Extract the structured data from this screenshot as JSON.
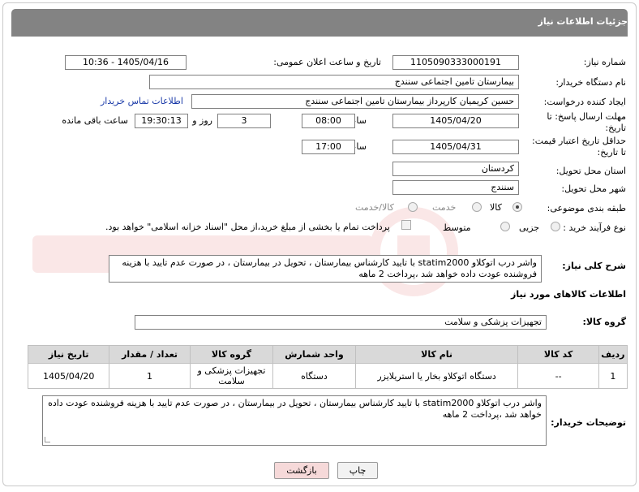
{
  "header": {
    "title": "جزئیات اطلاعات نیاز"
  },
  "form": {
    "need_number_label": "شماره نیاز:",
    "need_number": "1105090333000191",
    "announce_label": "تاریخ و ساعت اعلان عمومی:",
    "announce_value": "1405/04/16 - 10:36",
    "buyer_label": "نام دستگاه خریدار:",
    "buyer_value": "بیمارستان تامین اجتماعی سنندج",
    "creator_label": "ایجاد کننده درخواست:",
    "creator_value": "حسین کریمیان کارپرداز بیمارستان تامین اجتماعی سنندج",
    "contact_link": "اطلاعات تماس خریدار",
    "deadline_label_1": "مهلت ارسال پاسخ: تا",
    "deadline_label_2": "تاریخ:",
    "deadline_date": "1405/04/20",
    "hour_label": "ساعت",
    "deadline_time": "08:00",
    "days_value": "3",
    "days_label": "روز و",
    "remaining_time": "19:30:13",
    "remaining_label": "ساعت باقی مانده",
    "validity_label_1": "حداقل تاریخ اعتبار قیمت:",
    "validity_label_2": "تا تاریخ:",
    "validity_date": "1405/04/31",
    "validity_time": "17:00",
    "province_label": "استان محل تحویل:",
    "province_value": "کردستان",
    "city_label": "شهر محل تحویل:",
    "city_value": "سنندج",
    "category_label": "طبقه بندی موضوعی:",
    "category_options": [
      "کالا",
      "خدمت",
      "کالا/خدمت"
    ],
    "category_selected": "کالا",
    "process_label": "نوع فرآیند خرید :",
    "process_options": [
      "جزیی",
      "متوسط"
    ],
    "payment_note": "پرداخت تمام یا بخشی از مبلغ خرید،از محل \"اسناد خزانه اسلامی\" خواهد بود.",
    "description_label": "شرح کلی نیاز:",
    "description": "واشر  درب اتوکلاو  statim2000  با تایید کارشناس بیمارستان ، تحویل در بیمارستان ، در صورت عدم تایید با هزینه فروشنده عودت داده خواهد شد ،پرداخت 2 ماهه"
  },
  "goods": {
    "section_title": "اطلاعات کالاهای مورد نیاز",
    "group_label": "گروه کالا:",
    "group_value": "تجهیزات پزشکی و سلامت",
    "columns": [
      "ردیف",
      "کد کالا",
      "نام کالا",
      "واحد شمارش",
      "گروه کالا",
      "تعداد / مقدار",
      "تاریخ نیاز"
    ],
    "rows": [
      {
        "index": "1",
        "code": "--",
        "name": "دستگاه اتوکلاو بخار یا استریلایزر",
        "unit": "دستگاه",
        "group": "تجهیزات پزشکی و سلامت",
        "qty": "1",
        "date": "1405/04/20"
      }
    ]
  },
  "buyer_notes": {
    "label": "توضیحات خریدار:",
    "text": "واشر  درب اتوکلاو  statim2000  با تایید کارشناس بیمارستان ، تحویل در بیمارستان ، در صورت عدم تایید با هزینه فروشنده عودت داده خواهد شد ،پرداخت 2 ماهه"
  },
  "buttons": {
    "print": "چاپ",
    "back": "بازگشت"
  },
  "colors": {
    "header_bg": "#838383",
    "link": "#1a3aa8",
    "back_btn": "#f6d9d9"
  }
}
